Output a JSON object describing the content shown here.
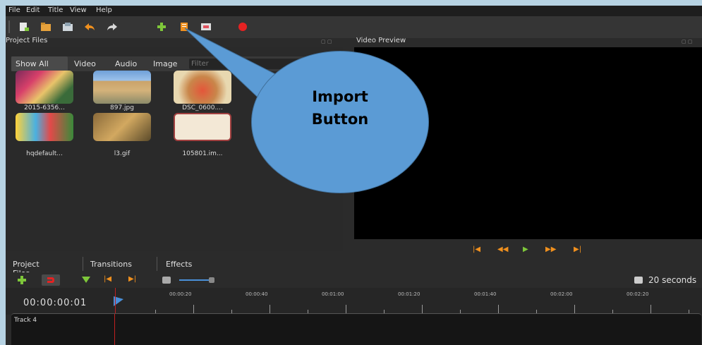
{
  "menu": {
    "file": "File",
    "edit": "Edit",
    "title": "Title",
    "view": "View",
    "help": "Help"
  },
  "toolbar": {
    "buttons": [
      "new-project-icon",
      "open-project-icon",
      "save-project-icon",
      "undo-icon",
      "redo-icon",
      "import-files-icon",
      "profile-icon",
      "fullscreen-icon",
      "export-video-icon"
    ]
  },
  "project_files": {
    "title": "Project Files",
    "filter_tabs": [
      "Show All",
      "Video",
      "Audio",
      "Image"
    ],
    "filter_placeholder": "Filter",
    "items": [
      {
        "label": "2015-6356..."
      },
      {
        "label": "897.jpg"
      },
      {
        "label": "DSC_0600...."
      },
      {
        "label": "hqdefault..."
      },
      {
        "label": "l3.gif"
      },
      {
        "label": "105801.im..."
      }
    ]
  },
  "video_preview": {
    "title": "Video Preview"
  },
  "bottom_tabs": [
    "Project Files",
    "Transitions",
    "Effects"
  ],
  "timeline": {
    "zoom_label": "20 seconds",
    "timecode": "00:00:00:01",
    "ruler_labels": [
      "00:00:20",
      "00:00:40",
      "00:01:00",
      "00:01:20",
      "00:01:40",
      "00:02:00",
      "00:02:20"
    ],
    "track_name": "Track 4"
  },
  "callout": {
    "line1": "Import",
    "line2": "Button"
  },
  "colors": {
    "accent_green": "#7ec73a",
    "accent_orange": "#f0901e",
    "callout_blue": "#5b9bd5",
    "record_red": "#e52222"
  }
}
